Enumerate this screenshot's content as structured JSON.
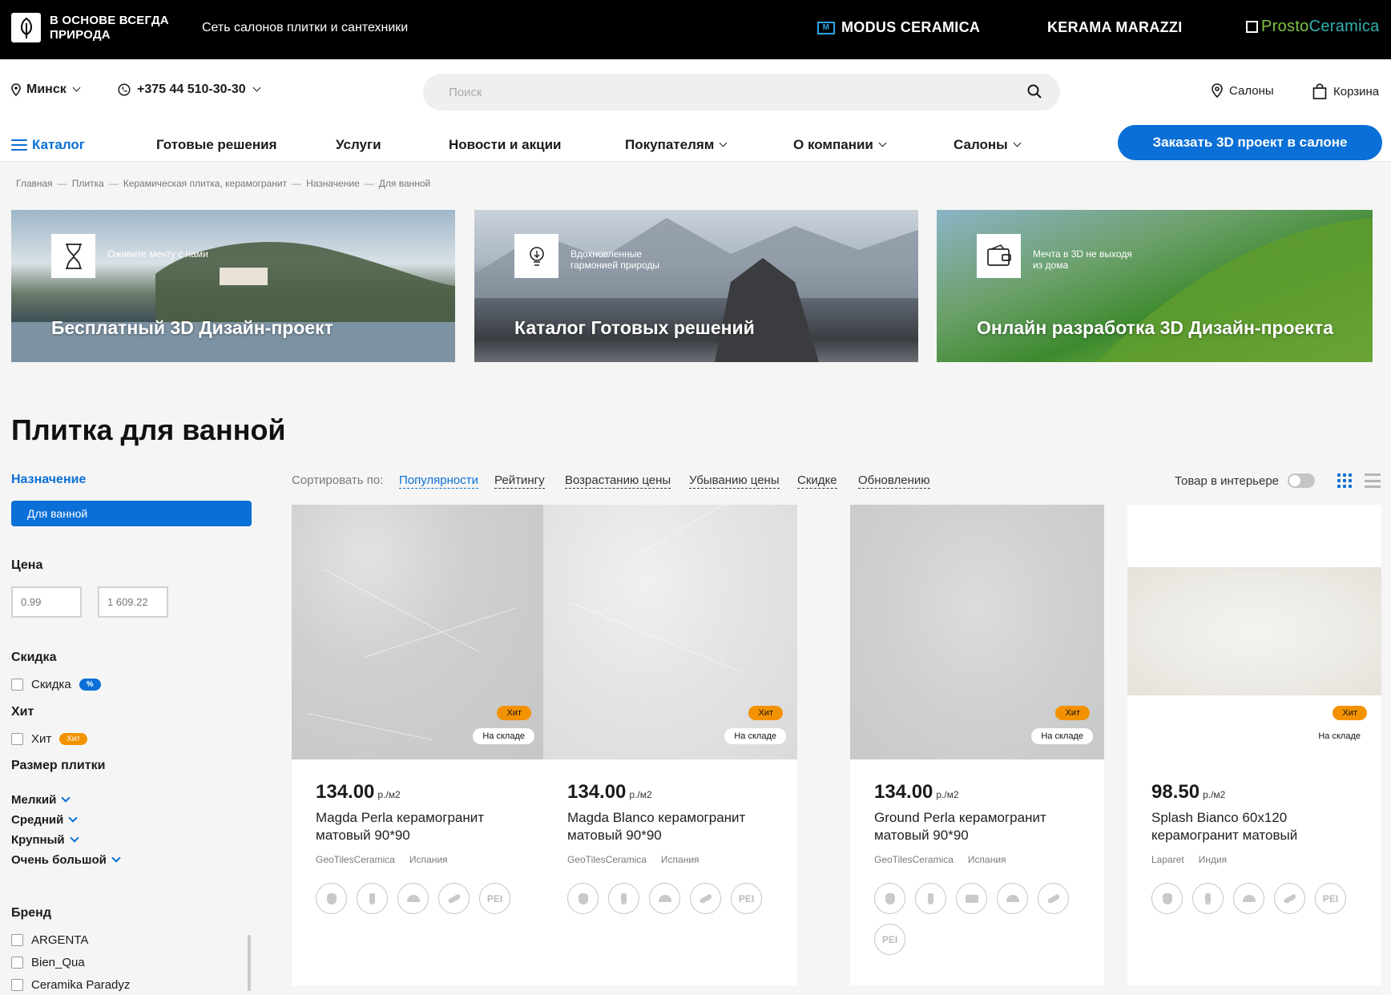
{
  "topbar": {
    "logo_text": "В ОСНОВЕ ВСЕГДА ПРИРОДА",
    "tagline": "Сеть салонов плитки и сантехники",
    "brands": [
      "MODUS CERAMICA",
      "KERAMA MARAZZI"
    ],
    "prosto_a": "Prosto",
    "prosto_b": "Ceramica",
    "modus_mark": "M"
  },
  "header": {
    "city": "Минск",
    "phone": "+375 44 510-30-30",
    "search_placeholder": "Поиск",
    "salons": "Салоны",
    "cart": "Корзина"
  },
  "nav": {
    "catalog": "Каталог",
    "items": [
      "Готовые решения",
      "Услуги",
      "Новости и акции",
      "Покупателям",
      "О компании",
      "Салоны"
    ],
    "cta": "Заказать 3D проект в салоне"
  },
  "breadcrumbs": [
    "Главная",
    "Плитка",
    "Керамическая плитка, керамогранит",
    "Назначение",
    "Для ванной"
  ],
  "banners": [
    {
      "small": "Оживите мечту с нами",
      "big": "Бесплатный 3D Дизайн-проект"
    },
    {
      "small": "Вдохновленные гармонией природы",
      "big": "Каталог Готовых решений"
    },
    {
      "small": "Мечта в 3D не выходя из дома",
      "big": "Онлайн разработка 3D Дизайн-проекта"
    }
  ],
  "page_title": "Плитка для ванной",
  "sidebar": {
    "purpose_title": "Назначение",
    "purpose_selected": "Для ванной",
    "price_title": "Цена",
    "price_min": "0.99",
    "price_max": "1 609.22",
    "discount_title": "Скидка",
    "discount_label": "Скидка",
    "discount_tag": "%",
    "hit_title": "Хит",
    "hit_label": "Хит",
    "hit_tag": "Хит",
    "size_title": "Размер плитки",
    "sizes": [
      "Мелкий",
      "Средний",
      "Крупный",
      "Очень большой"
    ],
    "brand_title": "Бренд",
    "brands": [
      "ARGENTA",
      "Bien_Qua",
      "Ceramika Paradyz"
    ]
  },
  "sort": {
    "label": "Сортировать по:",
    "options": [
      "Популярности",
      "Рейтингу",
      "Возрастанию цены",
      "Убыванию цены",
      "Скидке",
      "Обновлению"
    ],
    "active": "Популярности",
    "interior_label": "Товар в интерьере"
  },
  "products": [
    {
      "price": "134.00",
      "unit": "р./м2",
      "name": "Magda Perla керамогранит матовый 90*90",
      "brand": "GeoTilesCeramica",
      "country": "Испания",
      "hit": "Хит",
      "stock": "На складе",
      "props": [
        "hand",
        "foot",
        "wear",
        "slip",
        "PEI"
      ]
    },
    {
      "price": "134.00",
      "unit": "р./м2",
      "name": "Magda Blanco керамогранит матовый 90*90",
      "brand": "GeoTilesCeramica",
      "country": "Испания",
      "hit": "Хит",
      "stock": "На складе",
      "props": [
        "hand",
        "foot",
        "wear",
        "slip",
        "PEI"
      ]
    },
    {
      "price": "134.00",
      "unit": "р./м2",
      "name": "Ground Perla керамогранит матовый 90*90",
      "brand": "GeoTilesCeramica",
      "country": "Испания",
      "hit": "Хит",
      "stock": "На складе",
      "props": [
        "hand",
        "foot",
        "frost",
        "wear",
        "slip",
        "PEI"
      ]
    },
    {
      "price": "98.50",
      "unit": "р./м2",
      "name": "Splash Bianco 60x120 керамогранит матовый",
      "brand": "Laparet",
      "country": "Индия",
      "hit": "Хит",
      "stock": "На складе",
      "props": [
        "hand",
        "foot",
        "wear",
        "slip",
        "PEI"
      ]
    }
  ],
  "colors": {
    "accent": "#0a6fd6",
    "hit": "#f39200",
    "topbar": "#000000"
  }
}
